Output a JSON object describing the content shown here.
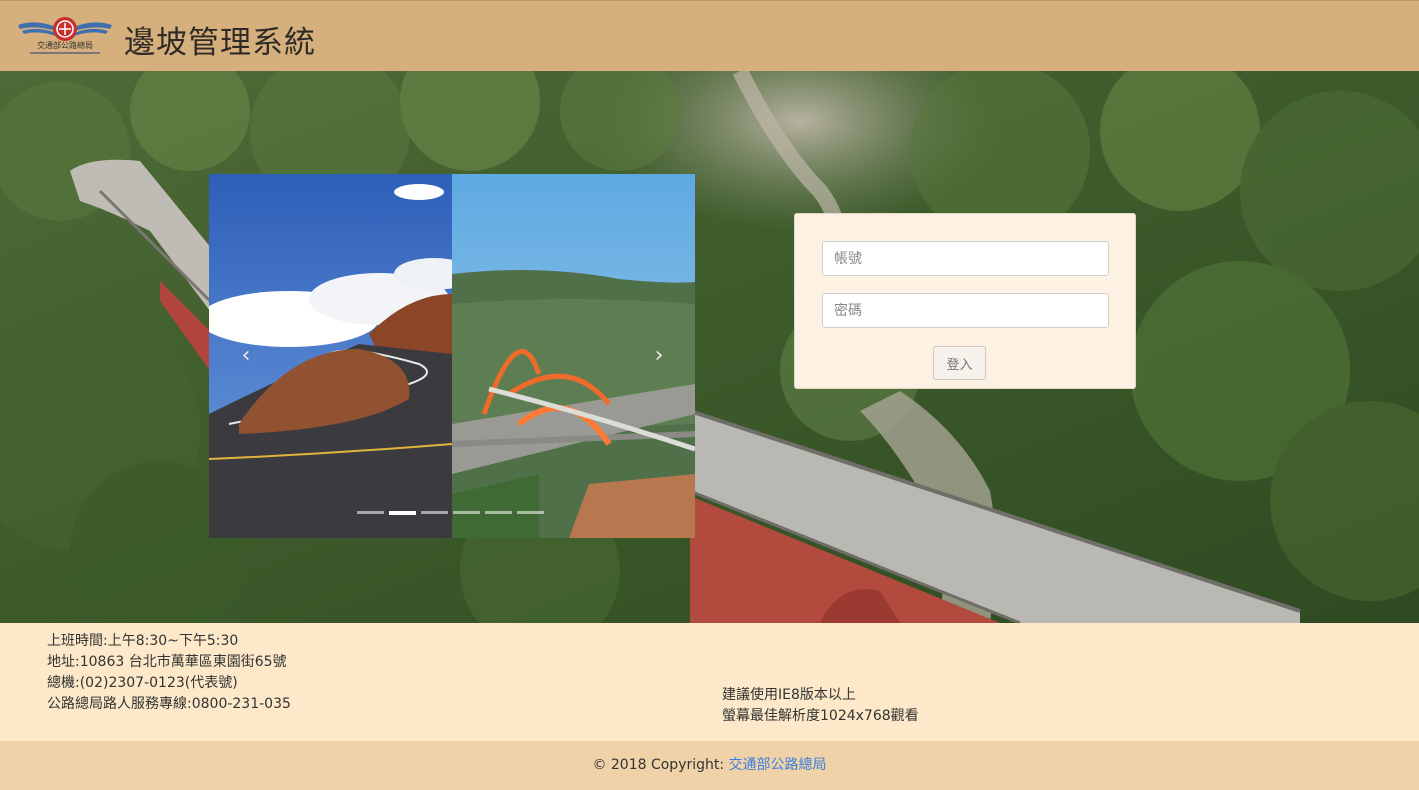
{
  "header": {
    "logo_text": "交通部公路總局",
    "title": "邊坡管理系統"
  },
  "carousel": {
    "prev_icon": "chevron-left-icon",
    "next_icon": "chevron-right-icon",
    "prev_glyph": "‹",
    "next_glyph": "›",
    "slide_count": 6,
    "active_index": 1
  },
  "login": {
    "account_placeholder": "帳號",
    "password_placeholder": "密碼",
    "submit_label": "登入"
  },
  "info": {
    "hours": "上班時間:上午8:30~下午5:30",
    "address": "地址:10863 台北市萬華區東園街65號",
    "phone": "總機:(02)2307-0123(代表號)",
    "hotline": "公路總局路人服務專線:0800-231-035",
    "browser_note": "建議使用IE8版本以上",
    "resolution_note": "螢幕最佳解析度1024x768觀看"
  },
  "footer": {
    "copyright_prefix": "© 2018 Copyright: ",
    "link_text": "交通部公路總局"
  },
  "colors": {
    "header_bg": "#d6b07c",
    "info_bg": "#fde9c9",
    "footer_bg": "#efd2a8",
    "link": "#3b7de0"
  }
}
